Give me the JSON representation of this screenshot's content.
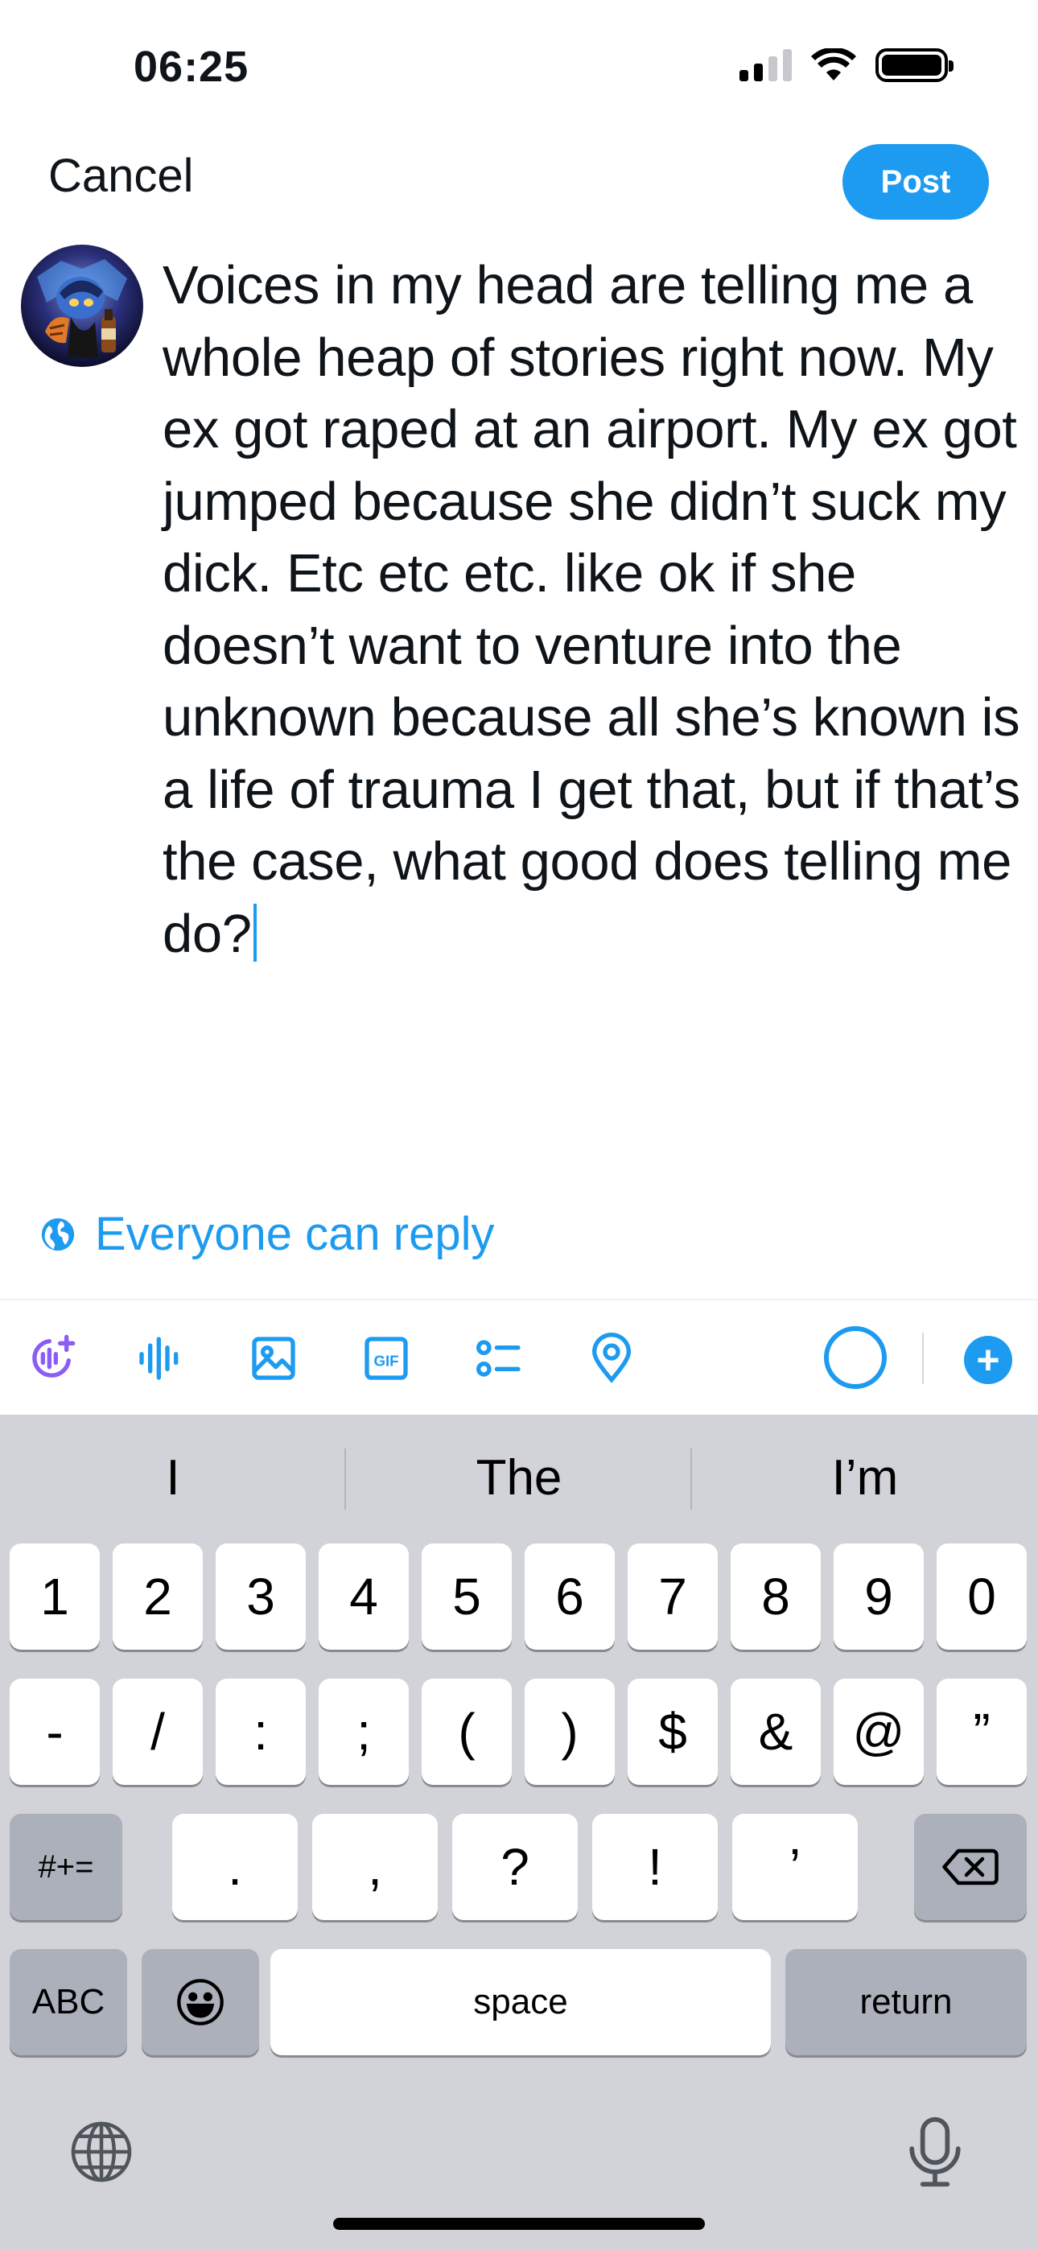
{
  "status_bar": {
    "time": "06:25"
  },
  "header": {
    "cancel_label": "Cancel",
    "post_label": "Post"
  },
  "composer": {
    "text": "Voices in my head are telling me a whole heap of stories right now. My ex got raped at an airport. My ex got jumped because she didn’t suck my dick. Etc etc etc. like ok if she doesn’t want to venture into the unknown because all she’s known is a life of trauma I get that, but if that’s the case, what good does telling me do?"
  },
  "reply_settings": {
    "label": "Everyone can reply"
  },
  "toolbar": {
    "icons": [
      "grok-icon",
      "voice-icon",
      "image-icon",
      "gif-icon",
      "poll-icon",
      "location-icon"
    ],
    "gif_text": "GIF"
  },
  "keyboard": {
    "suggestions": [
      "I",
      "The",
      "I’m"
    ],
    "row1": [
      "1",
      "2",
      "3",
      "4",
      "5",
      "6",
      "7",
      "8",
      "9",
      "0"
    ],
    "row2": [
      "-",
      "/",
      ":",
      ";",
      "(",
      ")",
      "$",
      "&",
      "@",
      "”"
    ],
    "row3_left": "#+=",
    "row3": [
      ".",
      ",",
      "?",
      "!",
      "’"
    ],
    "abc_label": "ABC",
    "space_label": "space",
    "return_label": "return"
  },
  "colors": {
    "accent": "#1d9bf0",
    "keyboard_bg": "#d1d3d9",
    "dark_key": "#abb0ba"
  }
}
